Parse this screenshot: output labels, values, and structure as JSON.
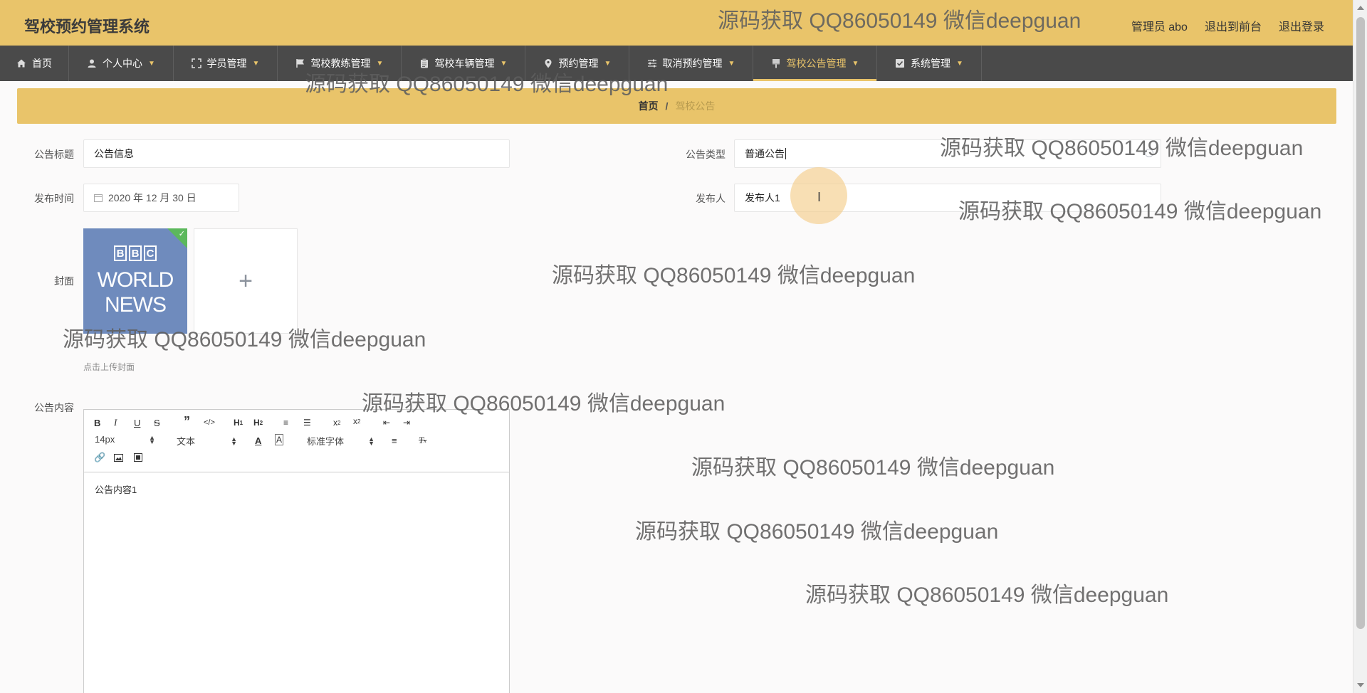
{
  "header": {
    "app_title": "驾校预约管理系统",
    "user_label": "管理员 abo",
    "front_link": "退出到前台",
    "logout_link": "退出登录"
  },
  "nav": {
    "items": [
      {
        "label": "首页",
        "icon": "home-icon",
        "has_menu": false,
        "active": false
      },
      {
        "label": "个人中心",
        "icon": "user-icon",
        "has_menu": true,
        "active": false
      },
      {
        "label": "学员管理",
        "icon": "expand-icon",
        "has_menu": true,
        "active": false
      },
      {
        "label": "驾校教练管理",
        "icon": "flag-icon",
        "has_menu": true,
        "active": false
      },
      {
        "label": "驾校车辆管理",
        "icon": "clipboard-icon",
        "has_menu": true,
        "active": false
      },
      {
        "label": "预约管理",
        "icon": "location-icon",
        "has_menu": true,
        "active": false
      },
      {
        "label": "取消预约管理",
        "icon": "sliders-icon",
        "has_menu": true,
        "active": false
      },
      {
        "label": "驾校公告管理",
        "icon": "brush-icon",
        "has_menu": true,
        "active": true
      },
      {
        "label": "系统管理",
        "icon": "checkbox-icon",
        "has_menu": true,
        "active": false
      }
    ]
  },
  "breadcrumb": {
    "home": "首页",
    "separator": "/",
    "current": "驾校公告"
  },
  "form": {
    "title_label": "公告标题",
    "title_value": "公告信息",
    "type_label": "公告类型",
    "type_value": "普通公告",
    "date_label": "发布时间",
    "date_value": "2020 年 12 月 30 日",
    "publisher_label": "发布人",
    "publisher_value": "发布人1",
    "cover_label": "封面",
    "cover_image_lines": [
      "BBC",
      "WORLD",
      "NEWS"
    ],
    "upload_plus": "+",
    "upload_hint": "点击上传封面",
    "content_label": "公告内容"
  },
  "editor": {
    "font_size": "14px",
    "header_select": "文本",
    "font_family": "标准字体",
    "content": "公告内容1"
  },
  "watermark_text": "源码获取 QQ86050149 微信deepguan",
  "colors": {
    "accent": "#e9c46a",
    "nav_bg": "#4a4a4a",
    "success": "#5cb85c"
  }
}
